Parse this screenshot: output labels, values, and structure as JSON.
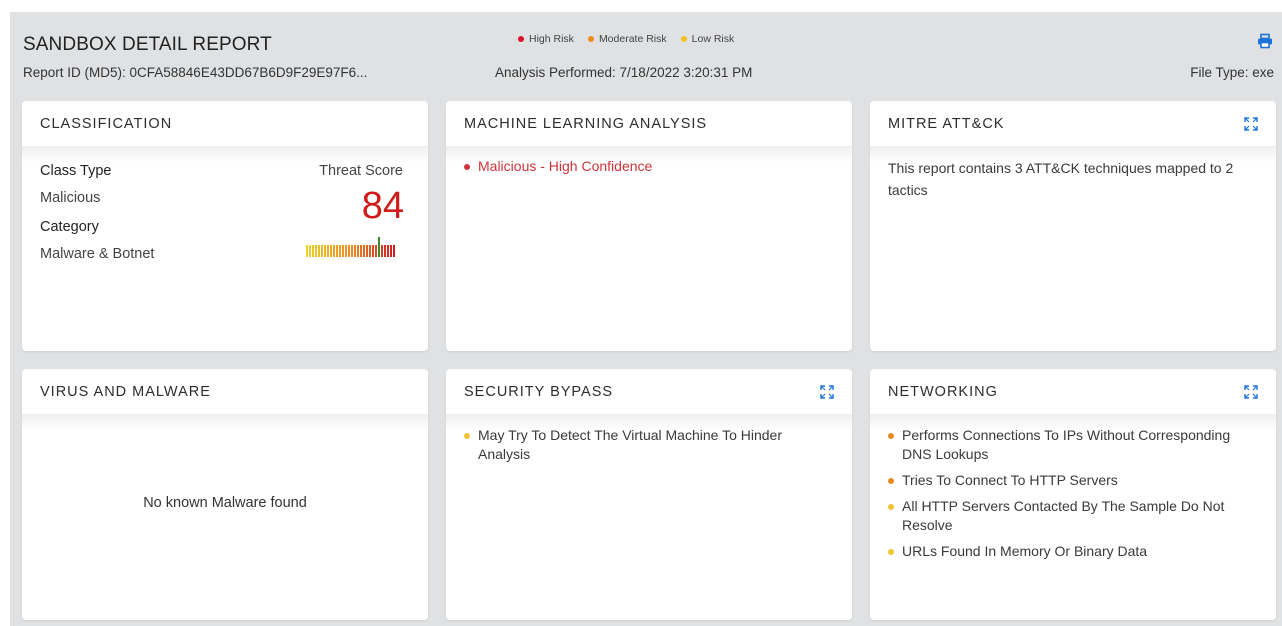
{
  "header": {
    "title": "SANDBOX DETAIL REPORT",
    "report_id": "Report ID (MD5): 0CFA58846E43DD67B6D9F29E97F6...",
    "analysis": "Analysis Performed: 7/18/2022 3:20:31 PM",
    "file_type": "File Type: exe",
    "print_icon": "printer-icon"
  },
  "legend": [
    {
      "label": "High Risk",
      "color": "#e0102a"
    },
    {
      "label": "Moderate Risk",
      "color": "#f08a1c"
    },
    {
      "label": "Low Risk",
      "color": "#f2c21b"
    }
  ],
  "classification": {
    "title": "CLASSIFICATION",
    "class_type_label": "Class Type",
    "class_type_value": "Malicious",
    "category_label": "Category",
    "category_value": "Malware & Botnet",
    "threat_score_label": "Threat Score",
    "threat_score": "84",
    "threat_score_fraction": 0.84
  },
  "ml": {
    "title": "MACHINE LEARNING ANALYSIS",
    "items": [
      "Malicious - High Confidence"
    ]
  },
  "mitre": {
    "title": "MITRE ATT&CK",
    "text": "This report contains 3 ATT&CK techniques mapped to 2 tactics"
  },
  "virus": {
    "title": "VIRUS AND MALWARE",
    "message": "No known Malware found"
  },
  "security": {
    "title": "SECURITY BYPASS",
    "items": [
      "May Try To Detect The Virtual Machine To Hinder Analysis"
    ]
  },
  "networking": {
    "title": "NETWORKING",
    "items": [
      "Performs Connections To IPs Without Corresponding DNS Lookups",
      "Tries To Connect To HTTP Servers",
      "All HTTP Servers Contacted By The Sample Do Not Resolve",
      "URLs Found In Memory Or Binary Data"
    ]
  },
  "colors": {
    "high": "#d0343a",
    "moderate": "#ea8a23",
    "low": "#f1c232",
    "score": "#d11a1a"
  }
}
